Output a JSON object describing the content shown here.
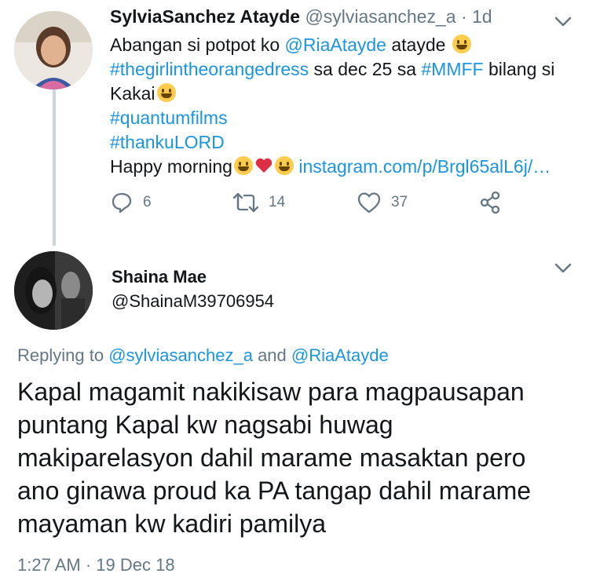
{
  "tweet1": {
    "name": "SylviaSanchez Atayde",
    "handle": "@sylviasanchez_a",
    "separator": "·",
    "time": "1d",
    "body": {
      "line1_text": "Abangan si potpot ko ",
      "line1_mention": "@RiaAtayde",
      "line1_tail": " atayde",
      "line2_hashtag1": "#thegirlintheorangedress",
      "line2_mid": " sa dec 25 sa ",
      "line2_hashtag2": "#MMFF",
      "line2_tail": " bilang si",
      "line3_text": "Kakai",
      "line4_hashtag": "#quantumfilms",
      "line5_hashtag": "#thankuLORD",
      "line6_text": "Happy morning",
      "line6_link": "instagram.com/p/Brgl65alL6j/…"
    },
    "actions": {
      "reply_count": "6",
      "retweet_count": "14",
      "like_count": "37"
    }
  },
  "tweet2": {
    "name": "Shaina Mae",
    "handle": "@ShainaM39706954",
    "replying_prefix": "Replying to ",
    "replying_user1": "@sylviasanchez_a",
    "replying_and": " and ",
    "replying_user2": "@RiaAtayde",
    "body_lines": [
      "Kapal magamit nakikisaw para magpausapan",
      "puntang Kapal kw nagsabi huwag",
      "makiparelasyon dahil marame masaktan pero",
      "ano ginawa proud ka PA tangap dahil marame",
      "mayaman kw kadiri pamilya"
    ],
    "timestamp": "1:27 AM · 19 Dec 18"
  },
  "colors": {
    "link": "#1b95e0",
    "secondary_text": "#657786",
    "thread_line": "#ccd6dd"
  },
  "icons": [
    "reply-icon",
    "retweet-icon",
    "like-icon",
    "share-icon",
    "chevron-down-icon"
  ]
}
